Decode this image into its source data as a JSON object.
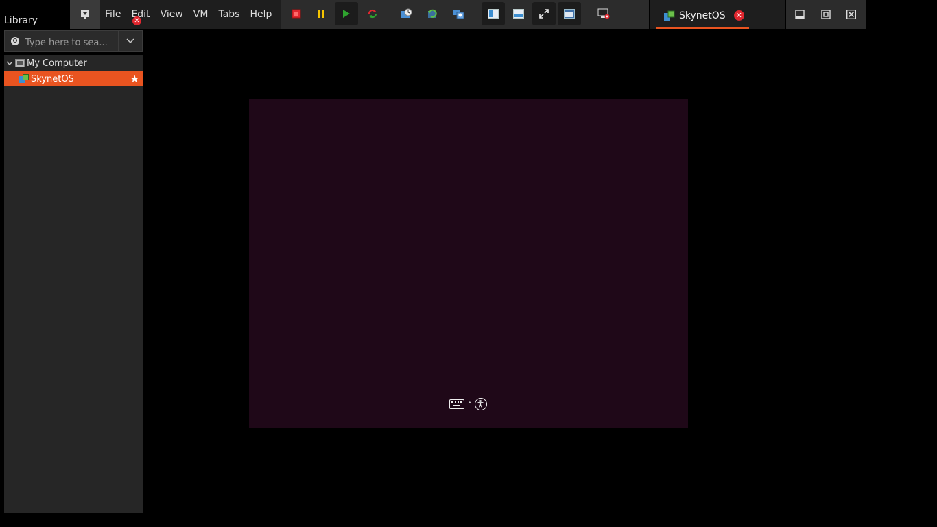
{
  "library": {
    "title": "Library",
    "search_placeholder": "Type here to sea...",
    "tree": [
      {
        "label": "My Computer",
        "icon": "computer-icon",
        "expanded": true
      },
      {
        "label": "SkynetOS",
        "icon": "vm-icon",
        "selected": true,
        "favorite": true
      }
    ]
  },
  "menu": {
    "items": [
      "File",
      "Edit",
      "View",
      "VM",
      "Tabs",
      "Help"
    ],
    "edit_badge": "✕"
  },
  "toolbar": {
    "buttons": [
      "power-off-icon",
      "suspend-icon",
      "power-on-icon",
      "reset-icon",
      "snapshot-take-icon",
      "snapshot-revert-icon",
      "snapshot-manager-icon",
      "show-library-icon",
      "thumbnail-bar-icon",
      "full-screen-icon",
      "unity-icon",
      "console-view-icon"
    ]
  },
  "tab": {
    "label": "SkynetOS",
    "close": "✕"
  },
  "window_controls": [
    "minimize-icon",
    "restore-icon",
    "close-icon"
  ],
  "vm": {
    "background": "#1f0818"
  },
  "colors": {
    "accent": "#e95420",
    "close_red": "#e0272f"
  }
}
